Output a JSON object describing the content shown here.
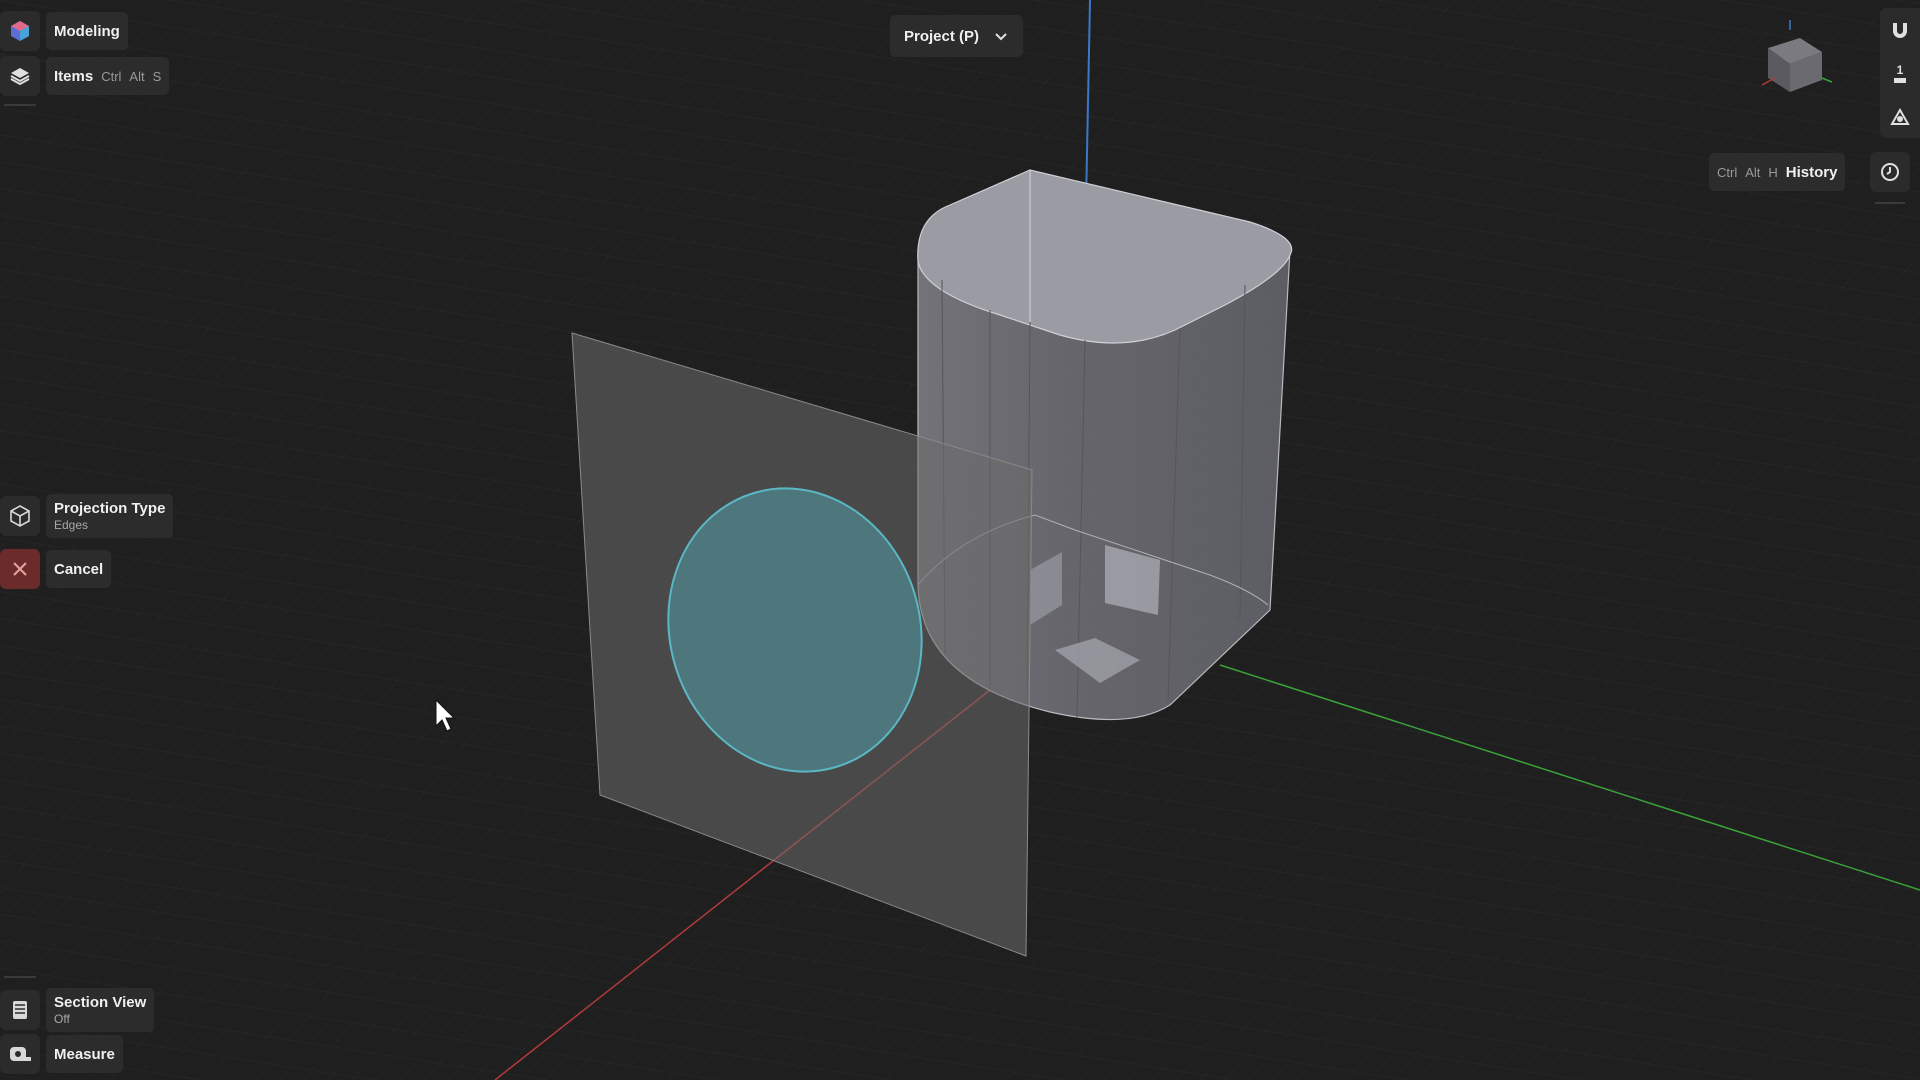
{
  "app": {
    "mode_label": "Modeling",
    "items_label": "Items",
    "items_shortcut": [
      "Ctrl",
      "Alt",
      "S"
    ]
  },
  "header": {
    "project_label": "Project (P)"
  },
  "tool_options": {
    "projection_type_label": "Projection Type",
    "projection_type_value": "Edges",
    "cancel_label": "Cancel"
  },
  "bottom_tools": {
    "section_view_label": "Section View",
    "section_view_value": "Off",
    "measure_label": "Measure"
  },
  "right_rail": {
    "history_label": "History",
    "history_shortcut": [
      "Ctrl",
      "Alt",
      "H"
    ],
    "unit_value": "1"
  },
  "icons": {
    "app_logo": "app-logo-icon",
    "layers": "layers-icon",
    "projection": "cube-projection-icon",
    "cancel": "close-icon",
    "section_view": "section-view-icon",
    "measure": "measure-tape-icon",
    "magnet": "magnet-icon",
    "camera_target": "camera-target-icon",
    "history": "clock-icon",
    "dropdown": "chevron-down-icon"
  },
  "colors": {
    "background": "#1f1f1f",
    "grid": "#2a2a2a",
    "axis_x": "#b23a3a",
    "axis_y": "#3aa33a",
    "axis_z": "#3a78c8",
    "cancel_bg": "#6b2b2b",
    "circle_fill": "#4f7e86",
    "circle_stroke": "#5ab8c4",
    "body_fill": "#8e8e96"
  }
}
